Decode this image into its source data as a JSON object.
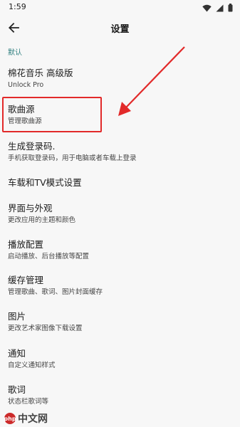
{
  "status_bar": {
    "time": "1:59"
  },
  "header": {
    "title": "设置"
  },
  "section": {
    "label": "默认"
  },
  "items": [
    {
      "title": "棉花音乐 高级版",
      "subtitle": "Unlock Pro"
    },
    {
      "title": "歌曲源",
      "subtitle": "管理歌曲源"
    },
    {
      "title": "生成登录码.",
      "subtitle": "手机获取登录码，用于电脑或者车载上登录"
    },
    {
      "title": "车载和TV模式设置",
      "subtitle": ""
    },
    {
      "title": "界面与外观",
      "subtitle": "更改应用的主题和颜色"
    },
    {
      "title": "播放配置",
      "subtitle": "启动播放、后台播放等配置"
    },
    {
      "title": "缓存管理",
      "subtitle": "管理歌曲、歌词、图片封面缓存"
    },
    {
      "title": "图片",
      "subtitle": "更改艺术家图像下载设置"
    },
    {
      "title": "通知",
      "subtitle": "自定义通知样式"
    },
    {
      "title": "歌词",
      "subtitle": "状态栏歌词等"
    }
  ],
  "watermark": {
    "logo": "php",
    "text": "中文网"
  },
  "colors": {
    "accent": "#2f7f7f",
    "highlight": "#e22a2a"
  }
}
